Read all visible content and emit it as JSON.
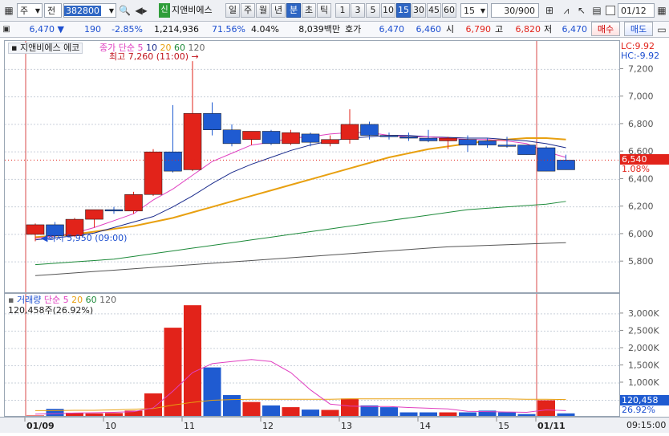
{
  "toolbar": {
    "market": "주",
    "prev": "전",
    "code": "382800",
    "name": "지앤비에스",
    "new_badge": "신",
    "periods": [
      "일",
      "주",
      "월",
      "년",
      "분",
      "초",
      "틱"
    ],
    "active_period": "분",
    "intervals": [
      "1",
      "3",
      "5",
      "10",
      "15",
      "30",
      "45",
      "60"
    ],
    "active_interval": "15",
    "interval_select": "15",
    "count": "30/900",
    "date": "01/12"
  },
  "quote": {
    "price": "6,470",
    "change": "190",
    "change_pct": "-2.85%",
    "volume": "1,214,936",
    "vol_ratio": "71.56%",
    "turnover": "4.04%",
    "amount": "8,039백만",
    "bid_label": "호가",
    "ask": "6,470",
    "bid": "6,460",
    "open_label": "시",
    "open": "6,790",
    "high_label": "고",
    "high": "6,820",
    "low_label": "저",
    "low": "6,470",
    "buy": "매수",
    "sell": "매도"
  },
  "price_legend": {
    "name": "지앤비에스 에코",
    "series": "종가 단순",
    "ma": [
      "5",
      "10",
      "20",
      "60",
      "120"
    ],
    "high_note": "최고 7,260 (11:00)",
    "low_note": "최저 5,950 (09:00)",
    "lc": "LC:9.92",
    "hc": "HC:-9.92",
    "current_tag": "6,540",
    "current_pct": "1.08%"
  },
  "volume_legend": {
    "name": "거래량",
    "series": "단순",
    "ma": [
      "5",
      "20",
      "60",
      "120"
    ],
    "last": "120,458주(26.92%)",
    "tag": "120,458",
    "tag_pct": "26.92%"
  },
  "dates": [
    "01/09",
    "10",
    "11",
    "12",
    "13",
    "14",
    "15",
    "01/11"
  ],
  "time": "09:15:00",
  "colors": {
    "up": "#e2231a",
    "down": "#1f5bd1",
    "ma5": "#e040c0",
    "ma10": "#1a2b8c",
    "ma20": "#e8a010",
    "ma60": "#1d8a3a",
    "ma120": "#555555"
  },
  "chart_data": [
    {
      "type": "candlestick",
      "title": "지앤비에스 에코",
      "y_ticks": [
        5800,
        6000,
        6200,
        6400,
        6600,
        6800,
        7000,
        7200
      ],
      "ylim": [
        5620,
        7360
      ],
      "candles": [
        {
          "o": 6000,
          "h": 6080,
          "l": 5950,
          "c": 6070
        },
        {
          "o": 6070,
          "h": 6090,
          "l": 5980,
          "c": 5990
        },
        {
          "o": 5990,
          "h": 6120,
          "l": 5980,
          "c": 6110
        },
        {
          "o": 6110,
          "h": 6180,
          "l": 6050,
          "c": 6180
        },
        {
          "o": 6180,
          "h": 6200,
          "l": 6150,
          "c": 6170
        },
        {
          "o": 6170,
          "h": 6310,
          "l": 6150,
          "c": 6290
        },
        {
          "o": 6290,
          "h": 6620,
          "l": 6280,
          "c": 6600
        },
        {
          "o": 6600,
          "h": 6940,
          "l": 6450,
          "c": 6460
        },
        {
          "o": 6470,
          "h": 7260,
          "l": 6460,
          "c": 6880
        },
        {
          "o": 6880,
          "h": 6960,
          "l": 6720,
          "c": 6760
        },
        {
          "o": 6760,
          "h": 6800,
          "l": 6640,
          "c": 6660
        },
        {
          "o": 6690,
          "h": 6750,
          "l": 6650,
          "c": 6750
        },
        {
          "o": 6750,
          "h": 6760,
          "l": 6650,
          "c": 6660
        },
        {
          "o": 6660,
          "h": 6760,
          "l": 6650,
          "c": 6740
        },
        {
          "o": 6730,
          "h": 6740,
          "l": 6640,
          "c": 6670
        },
        {
          "o": 6660,
          "h": 6720,
          "l": 6640,
          "c": 6690
        },
        {
          "o": 6690,
          "h": 6910,
          "l": 6660,
          "c": 6800
        },
        {
          "o": 6800,
          "h": 6820,
          "l": 6690,
          "c": 6720
        },
        {
          "o": 6720,
          "h": 6740,
          "l": 6690,
          "c": 6710
        },
        {
          "o": 6710,
          "h": 6740,
          "l": 6680,
          "c": 6700
        },
        {
          "o": 6700,
          "h": 6760,
          "l": 6670,
          "c": 6680
        },
        {
          "o": 6680,
          "h": 6710,
          "l": 6620,
          "c": 6700
        },
        {
          "o": 6690,
          "h": 6720,
          "l": 6600,
          "c": 6650
        },
        {
          "o": 6680,
          "h": 6700,
          "l": 6630,
          "c": 6650
        },
        {
          "o": 6650,
          "h": 6710,
          "l": 6630,
          "c": 6640
        },
        {
          "o": 6650,
          "h": 6650,
          "l": 6580,
          "c": 6580
        },
        {
          "o": 6630,
          "h": 6640,
          "l": 6460,
          "c": 6460
        },
        {
          "o": 6540,
          "h": 6580,
          "l": 6470,
          "c": 6470
        }
      ],
      "ma": {
        "ma5": [
          5970,
          5990,
          6010,
          6050,
          6100,
          6150,
          6250,
          6330,
          6430,
          6530,
          6590,
          6650,
          6670,
          6700,
          6710,
          6730,
          6740,
          6740,
          6720,
          6710,
          6710,
          6700,
          6690,
          6690,
          6680,
          6660,
          6600,
          6560
        ],
        "ma10": [
          5960,
          5975,
          5990,
          6010,
          6050,
          6090,
          6130,
          6200,
          6280,
          6370,
          6450,
          6510,
          6560,
          6610,
          6650,
          6680,
          6700,
          6710,
          6720,
          6720,
          6710,
          6705,
          6700,
          6700,
          6690,
          6680,
          6660,
          6630
        ],
        "ma20": [
          5980,
          5990,
          6000,
          6020,
          6040,
          6060,
          6090,
          6120,
          6160,
          6200,
          6240,
          6280,
          6320,
          6360,
          6400,
          6440,
          6480,
          6520,
          6560,
          6590,
          6620,
          6640,
          6660,
          6680,
          6690,
          6700,
          6700,
          6690
        ],
        "ma60": [
          5780,
          5790,
          5800,
          5810,
          5820,
          5840,
          5860,
          5880,
          5900,
          5920,
          5940,
          5960,
          5980,
          6000,
          6020,
          6040,
          6060,
          6080,
          6100,
          6120,
          6140,
          6160,
          6180,
          6190,
          6200,
          6210,
          6220,
          6240
        ],
        "ma120": [
          5700,
          5710,
          5720,
          5730,
          5740,
          5750,
          5760,
          5770,
          5780,
          5790,
          5800,
          5810,
          5820,
          5830,
          5840,
          5850,
          5860,
          5870,
          5880,
          5890,
          5900,
          5910,
          5915,
          5920,
          5925,
          5930,
          5935,
          5940
        ]
      }
    },
    {
      "type": "bar",
      "title": "거래량",
      "y_ticks": [
        500000,
        1000000,
        1500000,
        2000000,
        2500000,
        3000000
      ],
      "y_tick_labels": [
        "500,000",
        "1,000K",
        "1,500K",
        "2,000K",
        "2,500K",
        "3,000K"
      ],
      "ylim": [
        0,
        3300000
      ],
      "values": [
        60000,
        250000,
        140000,
        120000,
        130000,
        200000,
        700000,
        2600000,
        3250000,
        1450000,
        650000,
        450000,
        350000,
        300000,
        230000,
        220000,
        550000,
        350000,
        300000,
        150000,
        150000,
        150000,
        150000,
        200000,
        150000,
        100000,
        500000,
        120458
      ],
      "up": [
        1,
        0,
        1,
        1,
        1,
        1,
        1,
        1,
        1,
        0,
        0,
        1,
        0,
        1,
        0,
        1,
        1,
        0,
        0,
        0,
        0,
        1,
        0,
        0,
        0,
        0,
        1,
        0
      ],
      "ma5": [
        100000,
        110000,
        130000,
        140000,
        150000,
        170000,
        280000,
        760000,
        1300000,
        1560000,
        1620000,
        1680000,
        1620000,
        1300000,
        800000,
        390000,
        330000,
        320000,
        320000,
        290000,
        270000,
        250000,
        180000,
        170000,
        160000,
        150000,
        220000,
        200000
      ],
      "ma20": [
        200000,
        200000,
        210000,
        210000,
        220000,
        240000,
        260000,
        360000,
        440000,
        500000,
        520000,
        530000,
        530000,
        530000,
        530000,
        530000,
        540000,
        540000,
        540000,
        540000,
        540000,
        540000,
        540000,
        540000,
        540000,
        530000,
        530000,
        520000
      ]
    }
  ]
}
